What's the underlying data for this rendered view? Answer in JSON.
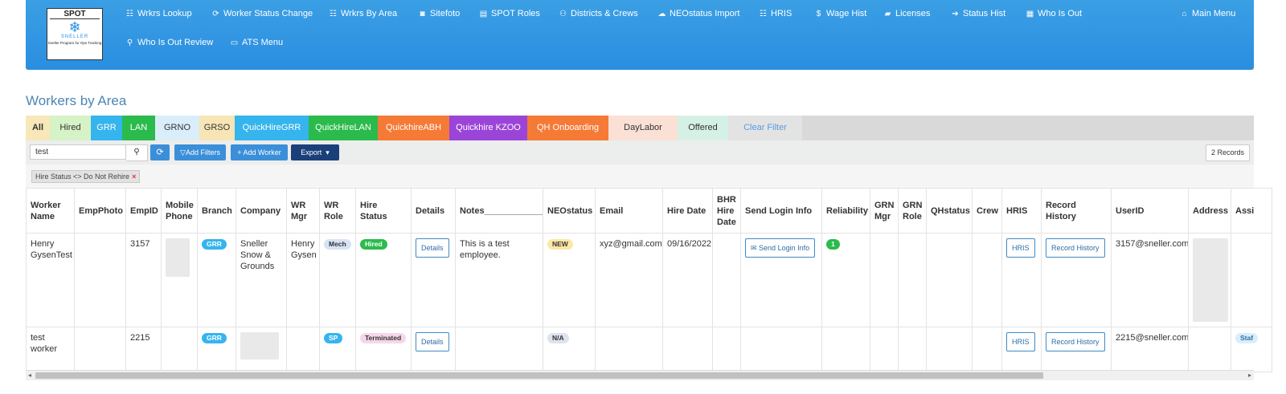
{
  "logo": {
    "title": "SPOT",
    "brand": "SNELLER",
    "tagline": "Sneller Program for Ops Tracking"
  },
  "nav": [
    {
      "label": "Wrkrs Lookup",
      "icon": "users-icon",
      "glyph": "☷"
    },
    {
      "label": "Worker Status Change",
      "icon": "refresh-icon",
      "glyph": "⟳"
    },
    {
      "label": "Wrkrs By Area",
      "icon": "group-icon",
      "glyph": "☷"
    },
    {
      "label": "Sitefoto",
      "icon": "camera-icon",
      "glyph": "◙"
    },
    {
      "label": "SPOT Roles",
      "icon": "document-icon",
      "glyph": "▤"
    },
    {
      "label": "Districts & Crews",
      "icon": "sitemap-icon",
      "glyph": "⚇"
    },
    {
      "label": "NEOstatus Import",
      "icon": "cloud-upload-icon",
      "glyph": "☁"
    },
    {
      "label": "HRIS",
      "icon": "users-icon",
      "glyph": "☷"
    },
    {
      "label": "Wage Hist",
      "icon": "dollar-icon",
      "glyph": "$"
    },
    {
      "label": "Licenses",
      "icon": "truck-icon",
      "glyph": "▰"
    },
    {
      "label": "Status Hist",
      "icon": "sign-out-icon",
      "glyph": "➔"
    },
    {
      "label": "Who Is Out",
      "icon": "calendar-icon",
      "glyph": "▦"
    },
    {
      "label": "Main Menu",
      "icon": "home-icon",
      "glyph": "⌂"
    },
    {
      "label": "Who Is Out Review",
      "icon": "search-icon",
      "glyph": "⚲"
    },
    {
      "label": "ATS Menu",
      "icon": "id-card-icon",
      "glyph": "▭"
    }
  ],
  "page_title": "Workers by Area",
  "tabs": [
    {
      "label": "All",
      "bg": "#f7e7b9",
      "color": "#333",
      "bold": true
    },
    {
      "label": "Hired",
      "bg": "#d6f2c7",
      "color": "#333"
    },
    {
      "label": "GRR",
      "bg": "#35b4ee",
      "color": "#fff"
    },
    {
      "label": "LAN",
      "bg": "#2bbb4c",
      "color": "#fff"
    },
    {
      "label": "GRNO",
      "bg": "#d9eefa",
      "color": "#333"
    },
    {
      "label": "GRSO",
      "bg": "#f8e5b5",
      "color": "#333"
    },
    {
      "label": "QuickHireGRR",
      "bg": "#35b4ee",
      "color": "#fff"
    },
    {
      "label": "QuickHireLAN",
      "bg": "#2bbb4c",
      "color": "#fff"
    },
    {
      "label": "QuickhireABH",
      "bg": "#f57a36",
      "color": "#fff"
    },
    {
      "label": "Quickhire KZOO",
      "bg": "#9b45d8",
      "color": "#fff"
    },
    {
      "label": "QH Onboarding",
      "bg": "#f57a36",
      "color": "#fff"
    },
    {
      "label": "DayLabor",
      "bg": "#fbe0d6",
      "color": "#333"
    },
    {
      "label": "Offered",
      "bg": "#d5f1e6",
      "color": "#333"
    },
    {
      "label": "Clear Filter",
      "bg": "#e3e3e3",
      "color": "#5a9be0"
    }
  ],
  "toolbar": {
    "search_value": "test",
    "add_filters": "Add Filters",
    "add_worker": "+ Add Worker",
    "export": "Export",
    "records": "2 Records"
  },
  "filter_chip": "Hire Status <> Do Not Rehire",
  "columns": [
    "Worker Name",
    "EmpPhoto",
    "EmpID",
    "Mobile Phone",
    "Branch",
    "Company",
    "WR Mgr",
    "WR Role",
    "Hire Status",
    "Details",
    "Notes____________",
    "NEOstatus",
    "Email",
    "Hire Date",
    "BHR Hire Date",
    "Send Login Info",
    "Reliability",
    "GRN Mgr",
    "GRN Role",
    "QHstatus",
    "Crew",
    "HRIS",
    "Record History",
    "UserID",
    "Address",
    "Assi"
  ],
  "rows": [
    {
      "worker_name": "Henry GysenTest",
      "emp_id": "3157",
      "branch": "GRR",
      "company": "Sneller Snow & Grounds",
      "wr_mgr": "Henry Gysen",
      "wr_role": "Mech",
      "hire_status": "Hired",
      "details": "Details",
      "notes": "This is a test employee.",
      "neostatus": "NEW",
      "email": "xyz@gmail.com",
      "hire_date": "09/16/2022",
      "send_login": "Send Login Info",
      "reliability": "1",
      "hris": "HRIS",
      "record_history": "Record History",
      "user_id": "3157@sneller.com",
      "assi": ""
    },
    {
      "worker_name": "test worker",
      "emp_id": "2215",
      "branch": "GRR",
      "company": "",
      "wr_mgr": "",
      "wr_role": "SP",
      "hire_status": "Terminated",
      "details": "Details",
      "notes": "",
      "neostatus": "N/A",
      "email": "",
      "hire_date": "",
      "send_login": "",
      "reliability": "",
      "hris": "HRIS",
      "record_history": "Record History",
      "user_id": "2215@sneller.com",
      "assi": "Staf"
    }
  ]
}
